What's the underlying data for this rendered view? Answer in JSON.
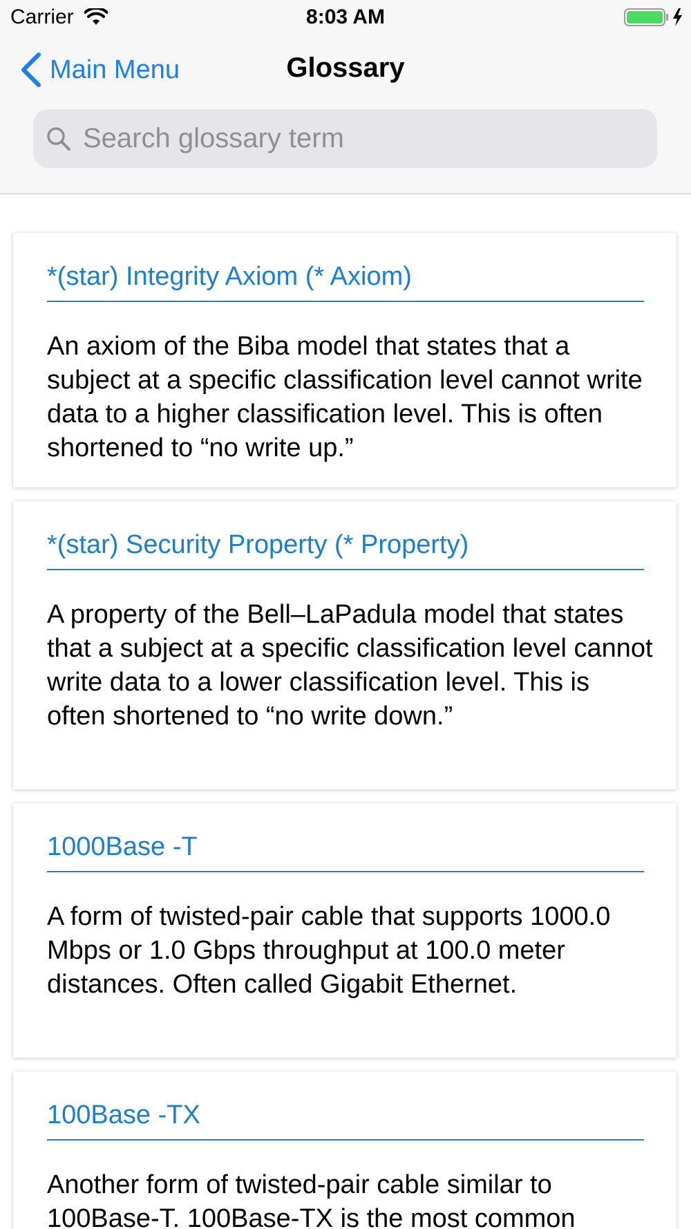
{
  "status_bar": {
    "carrier": "Carrier",
    "time": "8:03 AM"
  },
  "nav": {
    "back_label": "Main Menu",
    "title": "Glossary"
  },
  "search": {
    "placeholder": "Search glossary term",
    "value": ""
  },
  "colors": {
    "accent": "#1a7fd0",
    "back_link": "#1a7ff0",
    "battery": "#4cd964"
  },
  "entries": [
    {
      "term": "*(star) Integrity Axiom (* Axiom)",
      "definition": "An axiom of the Biba model that states that a subject at a specific classification level cannot write data to a higher classification level. This is often shortened to “no write up.”"
    },
    {
      "term": "*(star) Security Property (* Property)",
      "definition": "A property of the Bell–LaPadula model that states that a subject at a specific classification level cannot write data to a lower classification level. This is often shortened to “no write down.”"
    },
    {
      "term": "1000Base -T",
      "definition": "A form of twisted-pair cable that supports 1000.0 Mbps or 1.0 Gbps throughput at 100.0 meter distances. Often called Gigabit Ethernet."
    },
    {
      "term": "100Base -TX",
      "definition": "Another form of twisted-pair cable similar to 100Base-T. 100Base-TX is the most common"
    }
  ]
}
